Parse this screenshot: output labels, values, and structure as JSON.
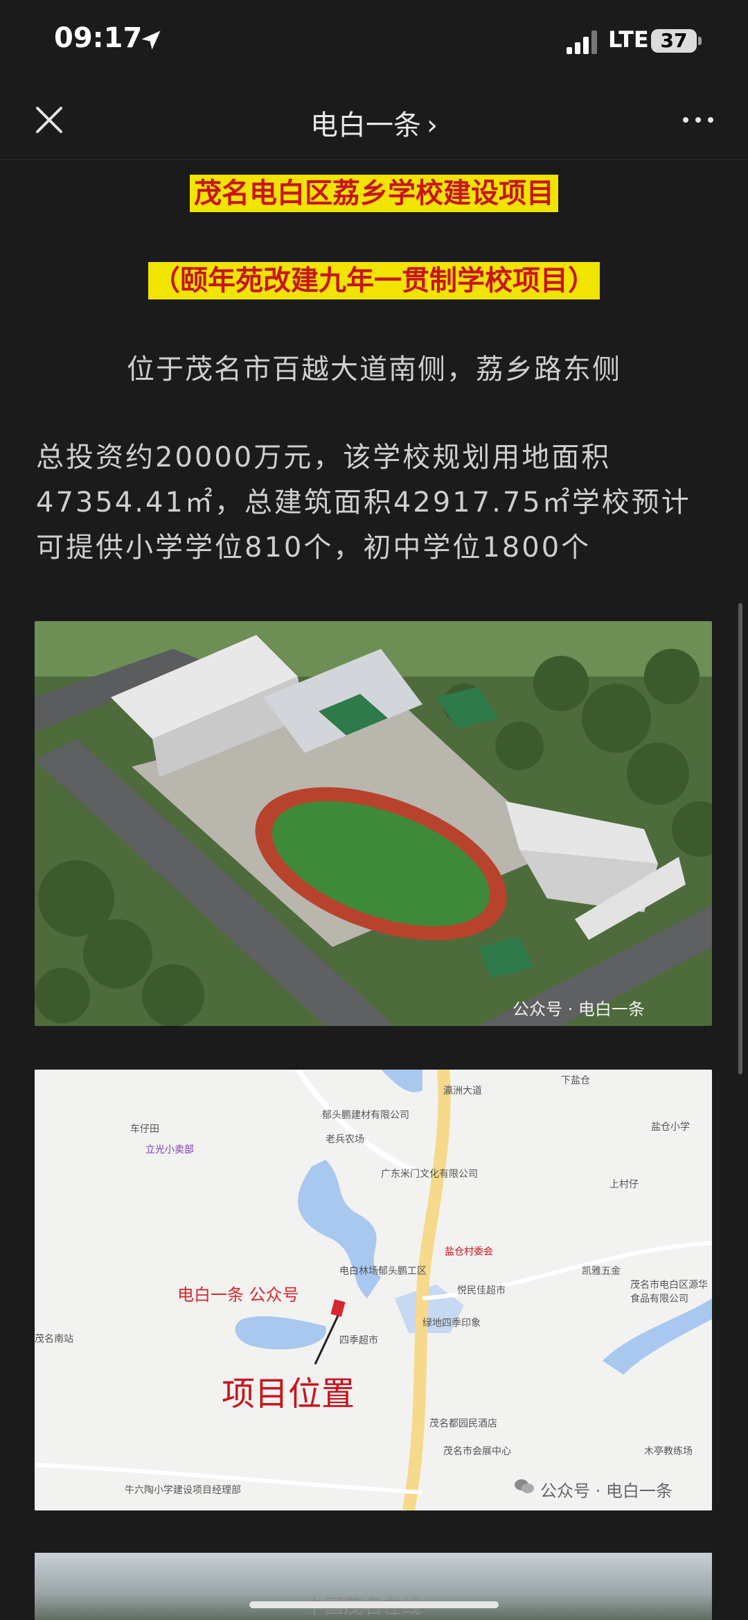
{
  "status_bar": {
    "time": "09:17",
    "network": "LTE",
    "battery": "37"
  },
  "nav": {
    "title": "电白一条",
    "chevron": "›"
  },
  "article": {
    "headline1": "茂名电白区荔乡学校建设项目",
    "headline2": "（颐年苑改建九年一贯制学校项目）",
    "location": "位于茂名市百越大道南侧，荔乡路东侧",
    "body": "总投资约20000万元，该学校规划用地面积47354.41㎡，总建筑面积42917.75㎡学校预计可提供小学学位810个，初中学位1800个",
    "image1_watermark": "公众号 · 电白一条",
    "map": {
      "brand_label": "电白一条 公众号",
      "location_label": "项目位置",
      "watermark": "公众号 · 电白一条",
      "place_labels": [
        "郁头鹏建材有限公司",
        "老兵农场",
        "广东米门文化有限公司",
        "车仔田",
        "立光小卖部",
        "盐仓村委会",
        "电白林场郁头鹏工区",
        "悦民佳超市",
        "绿地四季印象",
        "四季超市",
        "茂名都园民酒店",
        "茂名市会展中心",
        "凯雅五金",
        "盐仓小学",
        "上村仔",
        "下盐仓",
        "茂名南站",
        "瀛洲大道",
        "牛六陶小学建设项目经理部",
        "茂名市电白区源华食品有限公司",
        "木亭教练场"
      ]
    },
    "bottom_watermark": "中国茂名在线"
  },
  "colors": {
    "background": "#1b1b1b",
    "highlight_bg": "#f1e400",
    "highlight_text": "#c8141c",
    "text": "#cfcfcf"
  },
  "icons": {
    "location": "location-arrow-icon",
    "signal": "signal-bars-icon",
    "battery": "battery-icon",
    "close": "close-icon",
    "more": "more-dots-icon",
    "wechat": "wechat-icon"
  }
}
